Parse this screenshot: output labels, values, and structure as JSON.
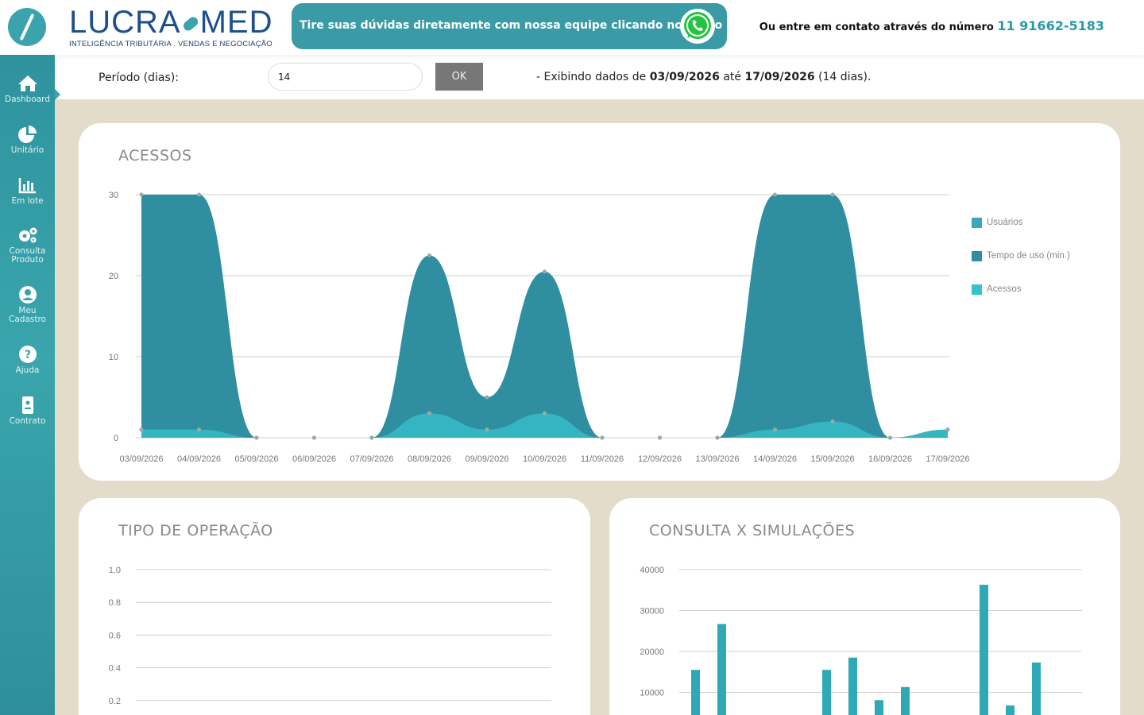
{
  "brand": {
    "name_left": "LUCRA",
    "name_right": "MED",
    "tagline": "INTELIGÊNCIA TRIBUTÁRIA . VENDAS E NEGOCIAÇÃO"
  },
  "header": {
    "whatsapp_text": "Tire suas dúvidas diretamente com nossa equipe clicando no botão",
    "contact_text": "Ou entre em contato através do número",
    "contact_phone": "11 91662-5183"
  },
  "sidebar": {
    "items": [
      {
        "label": "Dashboard",
        "icon": "home-icon"
      },
      {
        "label": "Unitário",
        "icon": "pie-chart-icon"
      },
      {
        "label": "Em lote",
        "icon": "bar-chart-icon"
      },
      {
        "label": "Consulta Produto",
        "icon": "gears-icon"
      },
      {
        "label": "Meu Cadastro",
        "icon": "user-icon"
      },
      {
        "label": "Ajuda",
        "icon": "help-icon"
      },
      {
        "label": "Contrato",
        "icon": "contract-icon"
      }
    ]
  },
  "period": {
    "label": "Período (dias):",
    "value": "14",
    "ok_label": "OK",
    "info_prefix": "- Exibindo dados de",
    "date_from": "03/09/2026",
    "info_mid": "até",
    "date_to": "17/09/2026",
    "info_suffix": "(14 dias)."
  },
  "colors": {
    "accent": "#3aa3ad",
    "series_tempo": "#2f8fa0",
    "series_acessos": "#35b3bf",
    "series_usuarios": "#3aa6b6"
  },
  "chart_data": [
    {
      "type": "area",
      "title": "ACESSOS",
      "x": [
        "03/09/2026",
        "04/09/2026",
        "05/09/2026",
        "06/09/2026",
        "07/09/2026",
        "08/09/2026",
        "09/09/2026",
        "10/09/2026",
        "11/09/2026",
        "12/09/2026",
        "13/09/2026",
        "14/09/2026",
        "15/09/2026",
        "16/09/2026",
        "17/09/2026"
      ],
      "series": [
        {
          "name": "Usuários",
          "values": [
            1,
            1,
            0,
            0,
            0,
            3,
            1,
            3,
            0,
            0,
            0,
            1,
            2,
            0,
            1
          ]
        },
        {
          "name": "Tempo de uso (min.)",
          "values": [
            30,
            30,
            0,
            0,
            0,
            22.5,
            5,
            20.5,
            0,
            0,
            0,
            30,
            30,
            0,
            1
          ]
        },
        {
          "name": "Acessos",
          "values": [
            1,
            1,
            0,
            0,
            0,
            3,
            1,
            3,
            0,
            0,
            0,
            1,
            2,
            0,
            1
          ]
        }
      ],
      "yticks": [
        0,
        10,
        20,
        30
      ],
      "ylim": [
        0,
        30
      ],
      "grid": true,
      "legend": "right"
    },
    {
      "type": "bar",
      "title": "TIPO DE OPERAÇÃO",
      "yticks": [
        "0.2",
        "0.4",
        "0.6",
        "0.8",
        "1.0"
      ],
      "ylim": [
        0,
        1
      ],
      "values": [],
      "grid": true
    },
    {
      "type": "bar",
      "title": "CONSULTA X SIMULAÇÕES",
      "yticks": [
        "10000",
        "20000",
        "30000",
        "40000"
      ],
      "ylim": [
        0,
        40000
      ],
      "values": [
        15500,
        26700,
        0,
        0,
        0,
        15500,
        18500,
        8100,
        11300,
        0,
        0,
        36300,
        6800,
        17300
      ],
      "grid": true
    }
  ]
}
